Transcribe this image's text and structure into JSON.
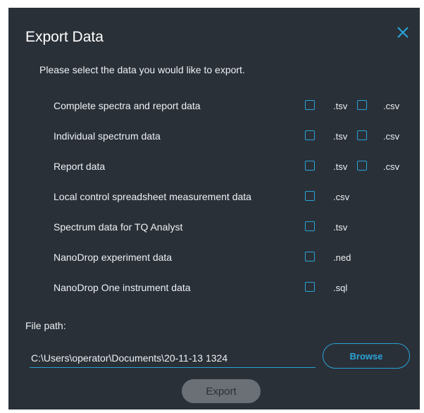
{
  "dialog": {
    "title": "Export Data",
    "close_icon": "close-icon",
    "subtitle": "Please select the data you would like to export.",
    "rows": [
      {
        "label": "Complete spectra and report data",
        "formats": [
          ".tsv",
          ".csv"
        ]
      },
      {
        "label": "Individual spectrum data",
        "formats": [
          ".tsv",
          ".csv"
        ]
      },
      {
        "label": "Report data",
        "formats": [
          ".tsv",
          ".csv"
        ]
      },
      {
        "label": "Local control spreadsheet measurement data",
        "formats": [
          ".csv"
        ]
      },
      {
        "label": "Spectrum data for TQ Analyst",
        "formats": [
          ".tsv"
        ]
      },
      {
        "label": "NanoDrop experiment data",
        "formats": [
          ".ned"
        ]
      },
      {
        "label": "NanoDrop One instrument data",
        "formats": [
          ".sql"
        ]
      }
    ],
    "file_path_label": "File path:",
    "file_path_value": "C:\\Users\\operator\\Documents\\20-11-13 1324",
    "browse_label": "Browse",
    "export_label": "Export",
    "export_enabled": false
  },
  "colors": {
    "background": "#2a3038",
    "accent": "#29a3d7",
    "text": "#eef1f4",
    "disabled_button": "#6b7077"
  }
}
